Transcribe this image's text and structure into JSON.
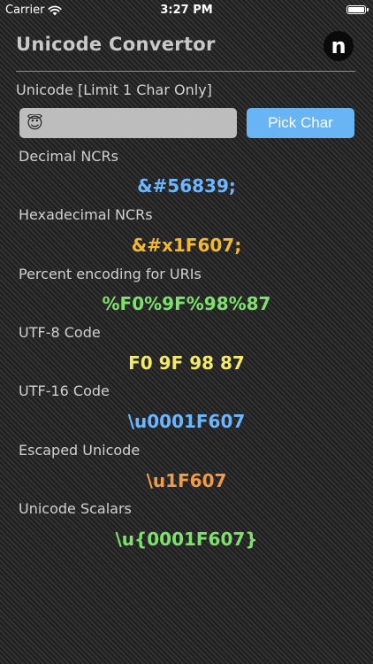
{
  "status_bar": {
    "carrier": "Carrier",
    "time": "3:27 PM"
  },
  "header": {
    "title": "Unicode Convertor",
    "logo_letter": "n"
  },
  "input": {
    "label": "Unicode [Limit 1 Char Only]",
    "value": "😇",
    "pick_button_label": "Pick Char"
  },
  "results": [
    {
      "label": "Decimal NCRs",
      "value": "&#56839;",
      "color": "#6cb6ff"
    },
    {
      "label": "Hexadecimal NCRs",
      "value": "&#x1F607;",
      "color": "#f5b82a"
    },
    {
      "label": "Percent encoding for URIs",
      "value": "%F0%9F%98%87",
      "color": "#7de26a"
    },
    {
      "label": "UTF-8 Code",
      "value": "F0 9F 98 87",
      "color": "#f3ea6a"
    },
    {
      "label": "UTF-16 Code",
      "value": "\\u0001F607",
      "color": "#6cb6ff"
    },
    {
      "label": "Escaped Unicode",
      "value": "\\u1F607",
      "color": "#f39a45"
    },
    {
      "label": "Unicode Scalars",
      "value": "\\u{0001F607}",
      "color": "#7de26a"
    }
  ]
}
